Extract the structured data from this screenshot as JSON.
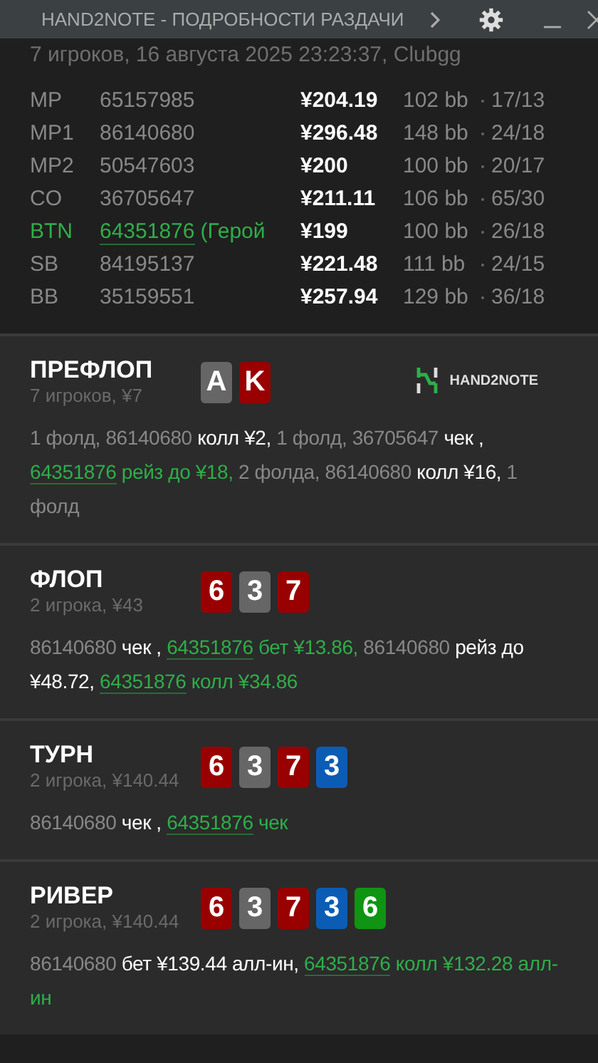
{
  "window": {
    "title": "HAND2NOTE - ПОДРОБНОСТИ РАЗДАЧИ"
  },
  "summary": "7 игроков, 16 августа 2025 23:23:37, Clubgg",
  "players": [
    {
      "position": "MP",
      "id": "65157985",
      "hero": false,
      "stack": "¥204.19",
      "bb": "102 bb",
      "stats": "17/13"
    },
    {
      "position": "MP1",
      "id": "86140680",
      "hero": false,
      "stack": "¥296.48",
      "bb": "148 bb",
      "stats": "24/18"
    },
    {
      "position": "MP2",
      "id": "50547603",
      "hero": false,
      "stack": "¥200",
      "bb": "100 bb",
      "stats": "20/17"
    },
    {
      "position": "CO",
      "id": "36705647",
      "hero": false,
      "stack": "¥211.11",
      "bb": "106 bb",
      "stats": "65/30"
    },
    {
      "position": "BTN",
      "id": "64351876",
      "hero": true,
      "note": "(Герой",
      "stack": "¥199",
      "bb": "100 bb",
      "stats": "26/18"
    },
    {
      "position": "SB",
      "id": "84195137",
      "hero": false,
      "stack": "¥221.48",
      "bb": "111 bb",
      "stats": "24/15"
    },
    {
      "position": "BB",
      "id": "35159551",
      "hero": false,
      "stack": "¥257.94",
      "bb": "129 bb",
      "stats": "36/18"
    }
  ],
  "streets": [
    {
      "name": "ПРЕФЛОП",
      "info": "7 игроков, ¥7",
      "logo": "HAND2NOTE",
      "cards": [
        {
          "rank": "A",
          "color": "#666666"
        },
        {
          "rank": "K",
          "color": "#990000"
        }
      ],
      "actions": [
        {
          "kind": "muted",
          "text": "1 фолд, 86140680 "
        },
        {
          "kind": "strong",
          "text": "колл ¥2,"
        },
        {
          "kind": "muted",
          "text": " 1 фолд, 36705647 "
        },
        {
          "kind": "strong",
          "text": "чек ,"
        },
        {
          "kind": "hero_id",
          "text": "64351876"
        },
        {
          "kind": "hero",
          "text": " рейз до ¥18,"
        },
        {
          "kind": "muted",
          "text": " 2 фолда, 86140680 "
        },
        {
          "kind": "strong",
          "text": "колл ¥16,"
        },
        {
          "kind": "muted",
          "text": " 1 фолд"
        }
      ]
    },
    {
      "name": "ФЛОП",
      "info": "2 игрока, ¥43",
      "cards": [
        {
          "rank": "6",
          "color": "#990000"
        },
        {
          "rank": "3",
          "color": "#666666"
        },
        {
          "rank": "7",
          "color": "#990000"
        }
      ],
      "actions": [
        {
          "kind": "muted",
          "text": "86140680 "
        },
        {
          "kind": "strong",
          "text": "чек ,"
        },
        {
          "kind": "hero_id",
          "text": "64351876"
        },
        {
          "kind": "hero",
          "text": " бет ¥13.86,"
        },
        {
          "kind": "muted",
          "text": " 86140680 "
        },
        {
          "kind": "strong",
          "text": "рейз до ¥48.72,"
        },
        {
          "kind": "hero_id",
          "text": "64351876"
        },
        {
          "kind": "hero",
          "text": " колл ¥34.86"
        }
      ]
    },
    {
      "name": "ТУРН",
      "info": "2 игрока, ¥140.44",
      "cards": [
        {
          "rank": "6",
          "color": "#990000"
        },
        {
          "rank": "3",
          "color": "#666666"
        },
        {
          "rank": "7",
          "color": "#990000"
        },
        {
          "rank": "3",
          "color": "#0b5cb5"
        }
      ],
      "actions": [
        {
          "kind": "muted",
          "text": "86140680 "
        },
        {
          "kind": "strong",
          "text": "чек ,"
        },
        {
          "kind": "hero_id",
          "text": "64351876"
        },
        {
          "kind": "hero",
          "text": " чек"
        }
      ]
    },
    {
      "name": "РИВЕР",
      "info": "2 игрока, ¥140.44",
      "cards": [
        {
          "rank": "6",
          "color": "#990000"
        },
        {
          "rank": "3",
          "color": "#666666"
        },
        {
          "rank": "7",
          "color": "#990000"
        },
        {
          "rank": "3",
          "color": "#0b5cb5"
        },
        {
          "rank": "6",
          "color": "#0f9414"
        }
      ],
      "actions": [
        {
          "kind": "muted",
          "text": "86140680 "
        },
        {
          "kind": "strong",
          "text": "бет ¥139.44 алл-ин,"
        },
        {
          "kind": "hero_id",
          "text": "64351876"
        },
        {
          "kind": "hero",
          "text": " колл ¥132.28 алл-ин"
        }
      ]
    }
  ]
}
